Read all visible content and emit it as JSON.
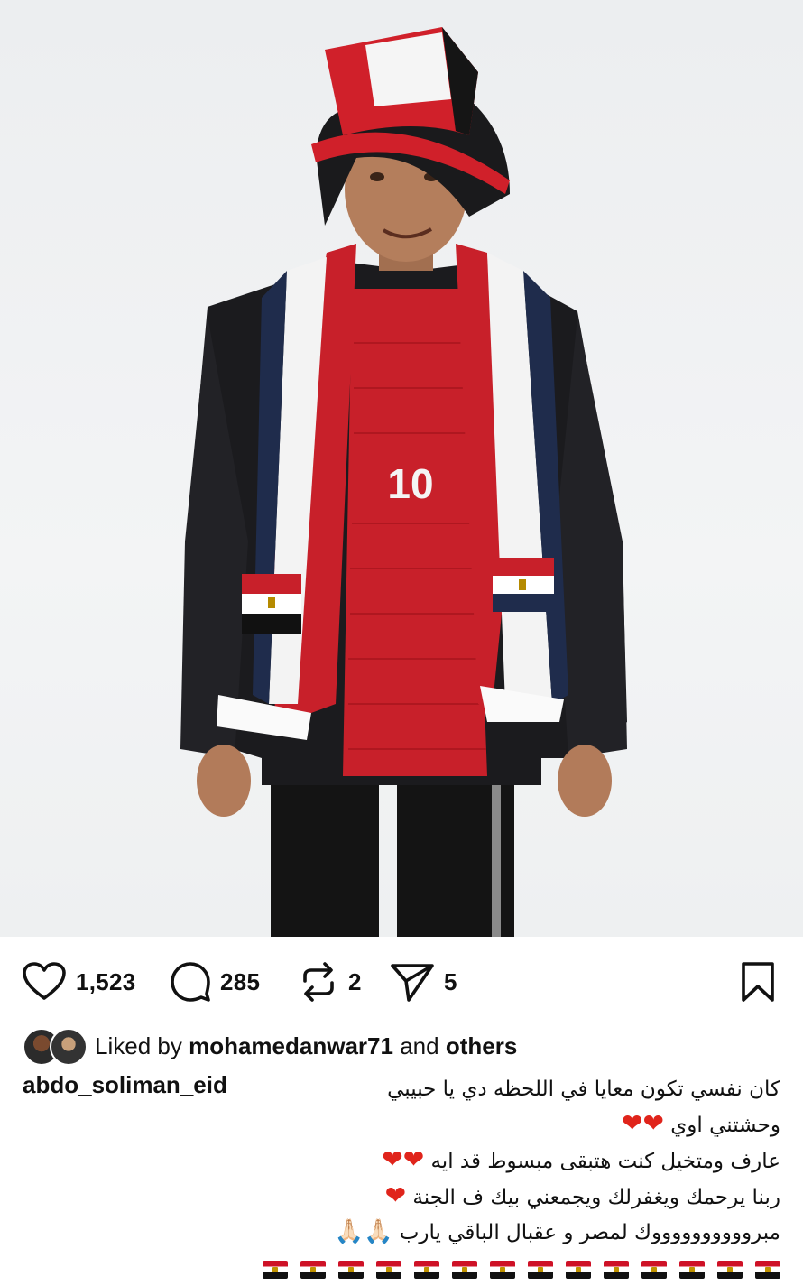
{
  "post": {
    "photo": {
      "alt_subject": "man-in-egypt-fan-outfit",
      "jersey_number": "10"
    },
    "actions": {
      "likes": "1,523",
      "comments": "285",
      "reposts": "2",
      "shares": "5"
    },
    "liked_by": {
      "prefix": "Liked by",
      "user": "mohamedanwar71",
      "and": "and",
      "others": "others"
    },
    "author": "abdo_soliman_eid",
    "caption": {
      "line1": "كان نفسي تكون معايا في اللحظه دي يا حبيبي",
      "line2": "وحشتني اوي",
      "line3": "عارف ومتخيل كنت هتبقى مبسوط قد ايه",
      "line4": "ربنا يرحمك ويغفرلك ويجمعني بيك ف الجنة",
      "line5": "مبرووووووووووك لمصر و عقبال الباقي يارب",
      "heart": "❤",
      "pray": "🙏🏻",
      "flag_count": 14
    },
    "colors": {
      "accent_red": "#e0241b",
      "text": "#111111",
      "flag_red": "#ce1126",
      "flag_black": "#111111"
    }
  }
}
